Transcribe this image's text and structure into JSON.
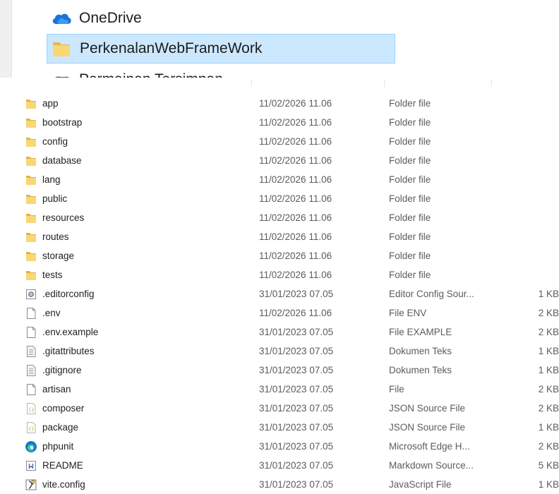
{
  "navigation_pane": {
    "items": [
      {
        "label": "OneDrive",
        "icon": "cloud-icon"
      },
      {
        "label": "PerkenalanWebFrameWork",
        "icon": "folder-icon",
        "selected": true
      },
      {
        "label": "Permainan Tersimpan",
        "icon": "saved-games-icon"
      }
    ]
  },
  "files": [
    {
      "name": "app",
      "modified": "11/02/2026 11.06",
      "type": "Folder file",
      "size": "",
      "icon": "folder-icon"
    },
    {
      "name": "bootstrap",
      "modified": "11/02/2026 11.06",
      "type": "Folder file",
      "size": "",
      "icon": "folder-icon"
    },
    {
      "name": "config",
      "modified": "11/02/2026 11.06",
      "type": "Folder file",
      "size": "",
      "icon": "folder-icon"
    },
    {
      "name": "database",
      "modified": "11/02/2026 11.06",
      "type": "Folder file",
      "size": "",
      "icon": "folder-icon"
    },
    {
      "name": "lang",
      "modified": "11/02/2026 11.06",
      "type": "Folder file",
      "size": "",
      "icon": "folder-icon"
    },
    {
      "name": "public",
      "modified": "11/02/2026 11.06",
      "type": "Folder file",
      "size": "",
      "icon": "folder-icon"
    },
    {
      "name": "resources",
      "modified": "11/02/2026 11.06",
      "type": "Folder file",
      "size": "",
      "icon": "folder-icon"
    },
    {
      "name": "routes",
      "modified": "11/02/2026 11.06",
      "type": "Folder file",
      "size": "",
      "icon": "folder-icon"
    },
    {
      "name": "storage",
      "modified": "11/02/2026 11.06",
      "type": "Folder file",
      "size": "",
      "icon": "folder-icon"
    },
    {
      "name": "tests",
      "modified": "11/02/2026 11.06",
      "type": "Folder file",
      "size": "",
      "icon": "folder-icon"
    },
    {
      "name": ".editorconfig",
      "modified": "31/01/2023 07.05",
      "type": "Editor Config Sour...",
      "size": "1 KB",
      "icon": "config-file-icon"
    },
    {
      "name": ".env",
      "modified": "11/02/2026 11.06",
      "type": "File ENV",
      "size": "2 KB",
      "icon": "blank-file-icon"
    },
    {
      "name": ".env.example",
      "modified": "31/01/2023 07.05",
      "type": "File EXAMPLE",
      "size": "2 KB",
      "icon": "blank-file-icon"
    },
    {
      "name": ".gitattributes",
      "modified": "31/01/2023 07.05",
      "type": "Dokumen Teks",
      "size": "1 KB",
      "icon": "text-file-icon"
    },
    {
      "name": ".gitignore",
      "modified": "31/01/2023 07.05",
      "type": "Dokumen Teks",
      "size": "1 KB",
      "icon": "text-file-icon"
    },
    {
      "name": "artisan",
      "modified": "31/01/2023 07.05",
      "type": "File",
      "size": "2 KB",
      "icon": "blank-file-icon"
    },
    {
      "name": "composer",
      "modified": "31/01/2023 07.05",
      "type": "JSON Source File",
      "size": "2 KB",
      "icon": "json-file-icon"
    },
    {
      "name": "package",
      "modified": "31/01/2023 07.05",
      "type": "JSON Source File",
      "size": "1 KB",
      "icon": "json-file-icon"
    },
    {
      "name": "phpunit",
      "modified": "31/01/2023 07.05",
      "type": "Microsoft Edge H...",
      "size": "2 KB",
      "icon": "edge-icon"
    },
    {
      "name": "README",
      "modified": "31/01/2023 07.05",
      "type": "Markdown Source...",
      "size": "5 KB",
      "icon": "markdown-file-icon"
    },
    {
      "name": "vite.config",
      "modified": "31/01/2023 07.05",
      "type": "JavaScript File",
      "size": "1 KB",
      "icon": "js-file-icon"
    }
  ],
  "colors": {
    "selection_bg": "#cce8ff",
    "selection_border": "#99d1ff",
    "folder_yellow": "#f8d775",
    "secondary_text": "#5c5c5c"
  }
}
